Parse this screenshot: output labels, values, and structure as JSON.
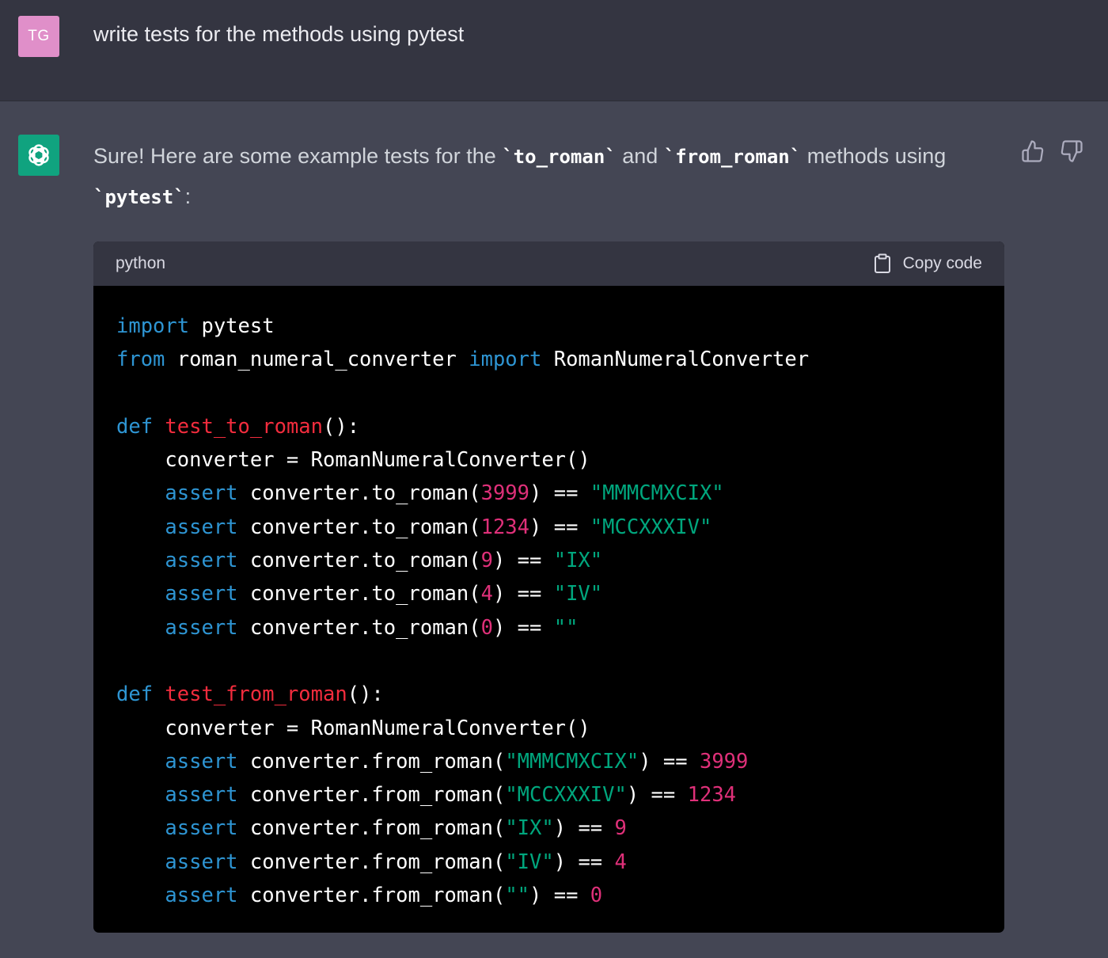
{
  "user_message": {
    "avatar_initials": "TG",
    "text": "write tests for the methods using pytest"
  },
  "assistant_message": {
    "avatar_icon": "openai-logo-icon",
    "text_parts": {
      "p1": "Sure! Here are some example tests for the ",
      "c1": "`to_roman`",
      "p2": " and ",
      "c2": "`from_roman`",
      "p3": " methods using ",
      "c3": "`pytest`",
      "p4": ":"
    },
    "feedback": {
      "up_icon": "thumbs-up-icon",
      "down_icon": "thumbs-down-icon"
    }
  },
  "code_block": {
    "language": "python",
    "copy_label": "Copy code",
    "copy_icon": "clipboard-icon",
    "colors": {
      "keyword": "#2e95d3",
      "function": "#f22c3d",
      "string": "#00a67d",
      "number": "#df3079"
    },
    "lines": [
      [
        [
          "kw",
          "import"
        ],
        [
          "t",
          " pytest"
        ]
      ],
      [
        [
          "kw",
          "from"
        ],
        [
          "t",
          " roman_numeral_converter "
        ],
        [
          "kw",
          "import"
        ],
        [
          "t",
          " RomanNumeralConverter"
        ]
      ],
      [],
      [
        [
          "kw",
          "def"
        ],
        [
          "t",
          " "
        ],
        [
          "fn",
          "test_to_roman"
        ],
        [
          "t",
          "():"
        ]
      ],
      [
        [
          "t",
          "    converter = RomanNumeralConverter()"
        ]
      ],
      [
        [
          "t",
          "    "
        ],
        [
          "kw",
          "assert"
        ],
        [
          "t",
          " converter.to_roman("
        ],
        [
          "num",
          "3999"
        ],
        [
          "t",
          ") == "
        ],
        [
          "str",
          "\"MMMCMXCIX\""
        ]
      ],
      [
        [
          "t",
          "    "
        ],
        [
          "kw",
          "assert"
        ],
        [
          "t",
          " converter.to_roman("
        ],
        [
          "num",
          "1234"
        ],
        [
          "t",
          ") == "
        ],
        [
          "str",
          "\"MCCXXXIV\""
        ]
      ],
      [
        [
          "t",
          "    "
        ],
        [
          "kw",
          "assert"
        ],
        [
          "t",
          " converter.to_roman("
        ],
        [
          "num",
          "9"
        ],
        [
          "t",
          ") == "
        ],
        [
          "str",
          "\"IX\""
        ]
      ],
      [
        [
          "t",
          "    "
        ],
        [
          "kw",
          "assert"
        ],
        [
          "t",
          " converter.to_roman("
        ],
        [
          "num",
          "4"
        ],
        [
          "t",
          ") == "
        ],
        [
          "str",
          "\"IV\""
        ]
      ],
      [
        [
          "t",
          "    "
        ],
        [
          "kw",
          "assert"
        ],
        [
          "t",
          " converter.to_roman("
        ],
        [
          "num",
          "0"
        ],
        [
          "t",
          ") == "
        ],
        [
          "str",
          "\"\""
        ]
      ],
      [],
      [
        [
          "kw",
          "def"
        ],
        [
          "t",
          " "
        ],
        [
          "fn",
          "test_from_roman"
        ],
        [
          "t",
          "():"
        ]
      ],
      [
        [
          "t",
          "    converter = RomanNumeralConverter()"
        ]
      ],
      [
        [
          "t",
          "    "
        ],
        [
          "kw",
          "assert"
        ],
        [
          "t",
          " converter.from_roman("
        ],
        [
          "str",
          "\"MMMCMXCIX\""
        ],
        [
          "t",
          ") == "
        ],
        [
          "num",
          "3999"
        ]
      ],
      [
        [
          "t",
          "    "
        ],
        [
          "kw",
          "assert"
        ],
        [
          "t",
          " converter.from_roman("
        ],
        [
          "str",
          "\"MCCXXXIV\""
        ],
        [
          "t",
          ") == "
        ],
        [
          "num",
          "1234"
        ]
      ],
      [
        [
          "t",
          "    "
        ],
        [
          "kw",
          "assert"
        ],
        [
          "t",
          " converter.from_roman("
        ],
        [
          "str",
          "\"IX\""
        ],
        [
          "t",
          ") == "
        ],
        [
          "num",
          "9"
        ]
      ],
      [
        [
          "t",
          "    "
        ],
        [
          "kw",
          "assert"
        ],
        [
          "t",
          " converter.from_roman("
        ],
        [
          "str",
          "\"IV\""
        ],
        [
          "t",
          ") == "
        ],
        [
          "num",
          "4"
        ]
      ],
      [
        [
          "t",
          "    "
        ],
        [
          "kw",
          "assert"
        ],
        [
          "t",
          " converter.from_roman("
        ],
        [
          "str",
          "\"\""
        ],
        [
          "t",
          ") == "
        ],
        [
          "num",
          "0"
        ]
      ]
    ]
  }
}
